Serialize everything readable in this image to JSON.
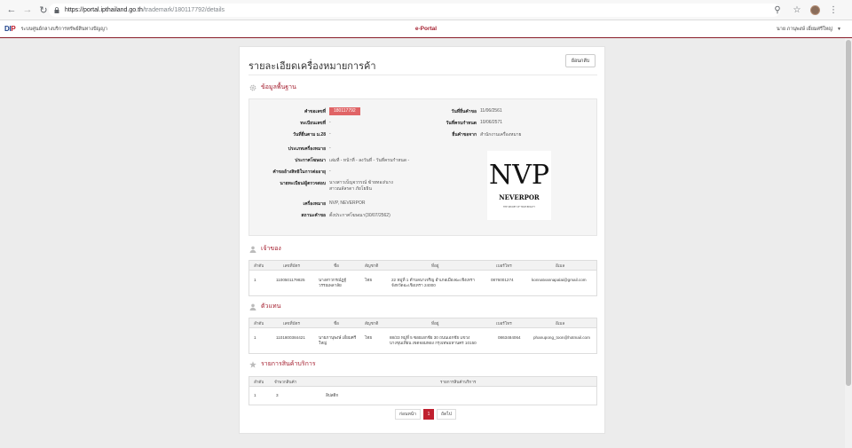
{
  "browser": {
    "url_host": "https://portal.ipthailand.go.th",
    "url_path": "/trademark/180117792/details"
  },
  "header": {
    "logo_main": "DI",
    "logo_accent": "P",
    "org_name": "ระบบศูนย์กลางบริการทรัพย์สินทางปัญญา",
    "portal_name": "e-Portal",
    "user_name": "นาย ภานุพงษ์ เอี่ยมศรีใหญ่"
  },
  "page": {
    "title": "รายละเอียดเครื่องหมายการค้า",
    "back_label": "ย้อนกลับ"
  },
  "basic": {
    "heading": "ข้อมูลพื้นฐาน",
    "left": [
      {
        "label": "คำขอเลขที่",
        "value": "180117792"
      },
      {
        "label": "ทะเบียนเลขที่",
        "value": "-"
      },
      {
        "label": "วันที่ยื่นตาม ม.28",
        "value": "-"
      },
      {
        "label": "ประเภทเครื่องหมาย",
        "value": "-"
      },
      {
        "label": "ประกาศโฆษณา",
        "value": "เล่มที่ - หน้าที่ - ลงวันที่ - วันที่ครบกำหนด -"
      },
      {
        "label": "คำขออ้างสิทธิในการต่ออายุ",
        "value": "-"
      },
      {
        "label": "นายทะเบียน/ผู้ตรวจสอบ",
        "value": "นางสาวเบ็ญจวรรณ์ ฆ้ายทอง/นางสาวณลัลรดา ภัยโยธิน"
      },
      {
        "label": "เครื่องหมาย",
        "value": "NVP, NEVERPOR"
      },
      {
        "label": "สถานะคำขอ",
        "value": "ตั้งประกาศโฆษณา(30/07/2562)"
      }
    ],
    "right": [
      {
        "label": "วันที่ยื่นคำขอ",
        "value": "11/06/2561"
      },
      {
        "label": "วันที่ครบกำหนด",
        "value": "10/06/2571"
      },
      {
        "label": "ยื่นคำขอจาก",
        "value": "สำนักงานเครื่องหมาย"
      }
    ],
    "mark_logo": {
      "top": "NVP",
      "name": "NEVERPOR",
      "tagline": "THE SECRET OF TRUE BEAUTY"
    }
  },
  "owner": {
    "heading": "เจ้าของ",
    "columns": [
      "ลำดับ",
      "เลขที่บัตร",
      "ชื่อ",
      "สัญชาติ",
      "ที่อยู่",
      "เบอร์โทร",
      "อีเมล"
    ],
    "rows": [
      [
        "1",
        "1100501179825",
        "นางสาวกรณ์ฎฐ์ วรรณพลาลัย",
        "ไทย",
        "22 หมู่ที่ 1 ตำบลนาเจริญ อำเภอเมืองฉะเชิงเทรา จังหวัดฉะเชิงเทรา 24000",
        "0876001274",
        "konnatvannapalai@gmail.com"
      ]
    ]
  },
  "agent": {
    "heading": "ตัวแทน",
    "columns": [
      "ลำดับ",
      "เลขที่บัตร",
      "ชื่อ",
      "สัญชาติ",
      "ที่อยู่",
      "เบอร์โทร",
      "อีเมล"
    ],
    "rows": [
      [
        "1",
        "1101800384421",
        "นายภานุพงษ์ เอี่ยมศรีใหญ่",
        "ไทย",
        "88/33 หมู่ที่ 5 ซอยเอกชัย 30 ถนนเอกชัย แขวงบางขุนเทียน เขตจอมทอง กรุงเทพมหานคร 10150",
        "0863484064",
        "phanupong_toon@hotmail.com"
      ]
    ]
  },
  "goods": {
    "heading": "รายการสินค้าบริการ",
    "columns": [
      "ลำดับ",
      "จำพวกสินค้า",
      "รายการสินค้าบริการ"
    ],
    "rows": [
      [
        "1",
        "3",
        "ลิปสติก"
      ]
    ]
  },
  "pagination": {
    "prev_label": "ก่อนหน้า",
    "current": "1",
    "next_label": "ถัดไป"
  }
}
